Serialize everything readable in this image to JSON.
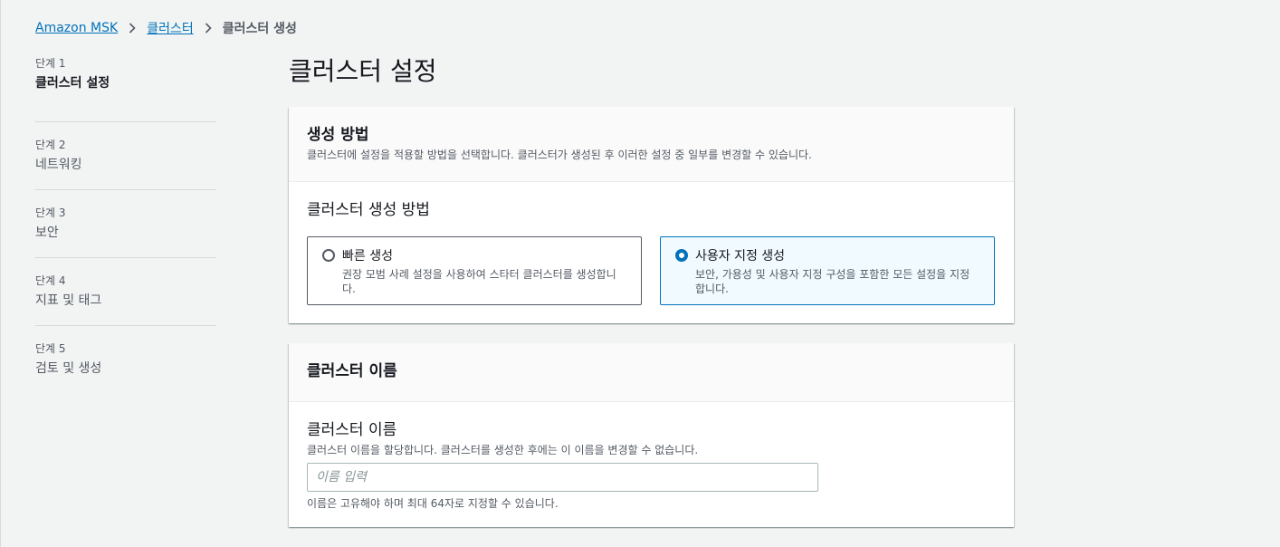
{
  "breadcrumb": {
    "items": [
      "Amazon MSK",
      "클러스터"
    ],
    "current": "클러스터 생성"
  },
  "steps": [
    {
      "num": "단계 1",
      "title": "클러스터 설정"
    },
    {
      "num": "단계 2",
      "title": "네트워킹"
    },
    {
      "num": "단계 3",
      "title": "보안"
    },
    {
      "num": "단계 4",
      "title": "지표 및 태그"
    },
    {
      "num": "단계 5",
      "title": "검토 및 생성"
    }
  ],
  "main": {
    "title": "클러스터 설정",
    "creation": {
      "header": "생성 방법",
      "description": "클러스터에 설정을 적용할 방법을 선택합니다. 클러스터가 생성된 후 이러한 설정 중 일부를 변경할 수 있습니다.",
      "label": "클러스터 생성 방법",
      "options": [
        {
          "title": "빠른 생성",
          "description": "권장 모범 사례 설정을 사용하여 스타터 클러스터를 생성합니다."
        },
        {
          "title": "사용자 지정 생성",
          "description": "보안, 가용성 및 사용자 지정 구성을 포함한 모든 설정을 지정합니다."
        }
      ],
      "selected": "사용자 지정 생성"
    },
    "name": {
      "header": "클러스터 이름",
      "label": "클러스터 이름",
      "description": "클러스터 이름을 할당합니다. 클러스터를 생성한 후에는 이 이름을 변경할 수 없습니다.",
      "placeholder": "이름 입력",
      "value": "",
      "constraint": "이름은 고유해야 하며 최대 64자로 지정할 수 있습니다."
    }
  },
  "colors": {
    "link": "#0073bb",
    "selected_border": "#0073bb",
    "selected_bg": "#f1faff",
    "page_bg": "#f2f3f3"
  }
}
